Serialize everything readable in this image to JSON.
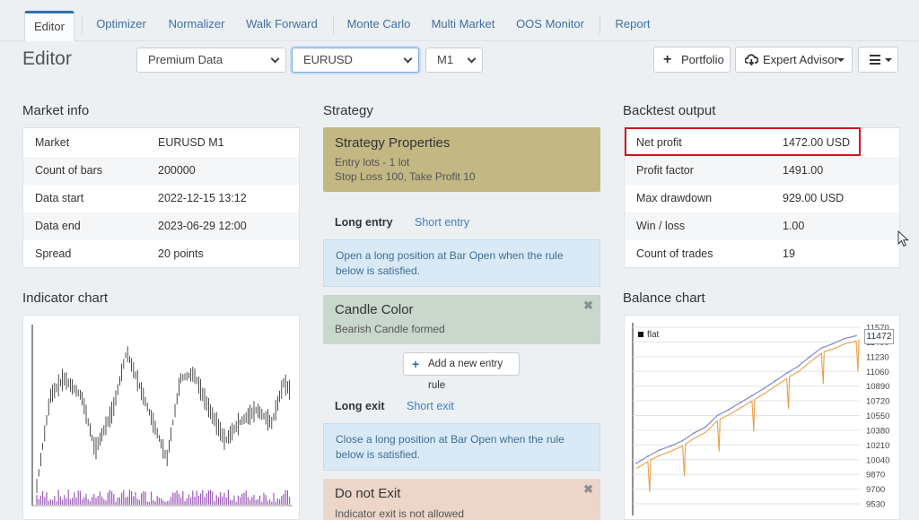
{
  "tabs": [
    {
      "label": "Editor"
    },
    {
      "label": "Optimizer"
    },
    {
      "label": "Normalizer"
    },
    {
      "label": "Walk Forward"
    },
    {
      "label": "Monte Carlo"
    },
    {
      "label": "Multi Market"
    },
    {
      "label": "OOS Monitor"
    },
    {
      "label": "Report"
    }
  ],
  "page_title": "Editor",
  "selectors": {
    "data_source": "Premium Data",
    "symbol": "EURUSD",
    "period": "M1"
  },
  "buttons": {
    "portfolio": "Portfolio",
    "expert_advisor": "Expert Advisor"
  },
  "market_info": {
    "title": "Market info",
    "rows": [
      {
        "key": "Market",
        "value": "EURUSD M1"
      },
      {
        "key": "Count of bars",
        "value": "200000"
      },
      {
        "key": "Data start",
        "value": "2022-12-15 13:12"
      },
      {
        "key": "Data end",
        "value": "2023-06-29 12:00"
      },
      {
        "key": "Spread",
        "value": "20 points"
      }
    ]
  },
  "indicator_chart": {
    "title": "Indicator chart"
  },
  "strategy": {
    "title": "Strategy",
    "properties": {
      "title": "Strategy Properties",
      "line1": "Entry lots - 1 lot",
      "line2": "Stop Loss 100, Take Profit 10"
    },
    "entry_tabs": {
      "active": "Long entry",
      "inactive": "Short entry"
    },
    "entry_info": "Open a long position at Bar Open when the rule below is satisfied.",
    "entry_rule": {
      "title": "Candle Color",
      "desc": "Bearish Candle formed"
    },
    "add_entry": "Add a new entry rule",
    "exit_tabs": {
      "active": "Long exit",
      "inactive": "Short exit"
    },
    "exit_info": "Close a long position at Bar Open when the rule below is satisfied.",
    "exit_rule": {
      "title": "Do not Exit",
      "desc": "Indicator exit is not allowed"
    }
  },
  "backtest": {
    "title": "Backtest output",
    "rows": [
      {
        "key": "Net profit",
        "value": "1472.00 USD"
      },
      {
        "key": "Profit factor",
        "value": "1491.00"
      },
      {
        "key": "Max drawdown",
        "value": "929.00 USD"
      },
      {
        "key": "Win / loss",
        "value": "1.00"
      },
      {
        "key": "Count of trades",
        "value": "19"
      }
    ]
  },
  "balance_chart": {
    "title": "Balance chart",
    "legend": "flat",
    "current_value": "11472",
    "y_ticks": [
      "11570",
      "11400",
      "11230",
      "11060",
      "10890",
      "10720",
      "10550",
      "10380",
      "10210",
      "10040",
      "9870",
      "9700",
      "9530"
    ]
  },
  "colors": {
    "accent": "#2f6eb0",
    "highlight_box": "#d0141d",
    "strategy_props": "#c3b783",
    "rule_green": "#c9d7cd",
    "exit_rule": "#ecd6c9",
    "balance_line": "#e8a04a",
    "equity_line": "#7d8cc4"
  },
  "chart_data": [
    {
      "type": "ohlc",
      "description_visible": "Indicator chart: price bars with purple volume bars below",
      "series": []
    },
    {
      "type": "line",
      "ylim": [
        9530,
        11570
      ],
      "y_ticks": [
        11570,
        11400,
        11230,
        11060,
        10890,
        10720,
        10550,
        10380,
        10210,
        10040,
        9870,
        9700,
        9530
      ],
      "series": [
        {
          "name": "flat",
          "values": [
            10000,
            10080,
            10150,
            10200,
            10260,
            10350,
            10420,
            10550,
            10620,
            10700,
            10780,
            10860,
            10950,
            11040,
            11120,
            11230,
            11330,
            11380,
            11440,
            11472
          ]
        }
      ]
    }
  ]
}
